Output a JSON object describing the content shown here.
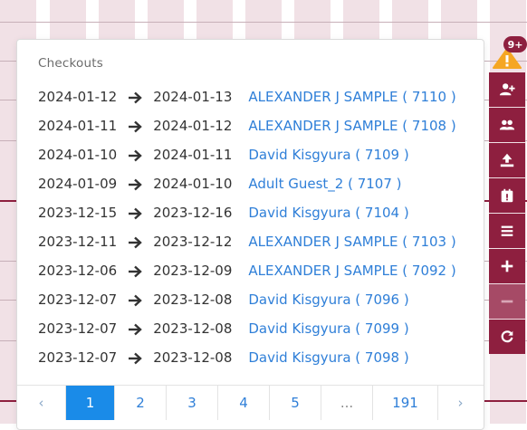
{
  "checkouts": {
    "title": "Checkouts",
    "rows": [
      {
        "from": "2024-01-12",
        "to": "2024-01-13",
        "guest": "ALEXANDER J SAMPLE ( 7110 )"
      },
      {
        "from": "2024-01-11",
        "to": "2024-01-12",
        "guest": "ALEXANDER J SAMPLE ( 7108 )"
      },
      {
        "from": "2024-01-10",
        "to": "2024-01-11",
        "guest": "David Kisgyura ( 7109 )"
      },
      {
        "from": "2024-01-09",
        "to": "2024-01-10",
        "guest": "Adult Guest_2 ( 7107 )"
      },
      {
        "from": "2023-12-15",
        "to": "2023-12-16",
        "guest": "David Kisgyura ( 7104 )"
      },
      {
        "from": "2023-12-11",
        "to": "2023-12-12",
        "guest": "ALEXANDER J SAMPLE ( 7103 )"
      },
      {
        "from": "2023-12-06",
        "to": "2023-12-09",
        "guest": "ALEXANDER J SAMPLE ( 7092 )"
      },
      {
        "from": "2023-12-07",
        "to": "2023-12-08",
        "guest": "David Kisgyura ( 7096 )"
      },
      {
        "from": "2023-12-07",
        "to": "2023-12-08",
        "guest": "David Kisgyura ( 7099 )"
      },
      {
        "from": "2023-12-07",
        "to": "2023-12-08",
        "guest": "David Kisgyura ( 7098 )"
      }
    ]
  },
  "pagination": {
    "prev": "‹",
    "pages": [
      "1",
      "2",
      "3",
      "4",
      "5",
      "...",
      "191"
    ],
    "active": "1",
    "next": "›"
  },
  "notifications": {
    "badge": "9+",
    "icon": "warning-icon",
    "color": "#f5a623"
  },
  "toolbar": {
    "buttons": [
      {
        "icon": "add-user-icon"
      },
      {
        "icon": "users-icon"
      },
      {
        "icon": "upload-icon"
      },
      {
        "icon": "calendar-exclamation-icon"
      },
      {
        "icon": "list-icon"
      },
      {
        "icon": "plus-icon"
      },
      {
        "icon": "minus-icon"
      },
      {
        "icon": "refresh-icon"
      }
    ]
  },
  "colors": {
    "accent": "#8e1f3f",
    "link": "#2f7fd8",
    "active_page": "#1a8be8"
  }
}
